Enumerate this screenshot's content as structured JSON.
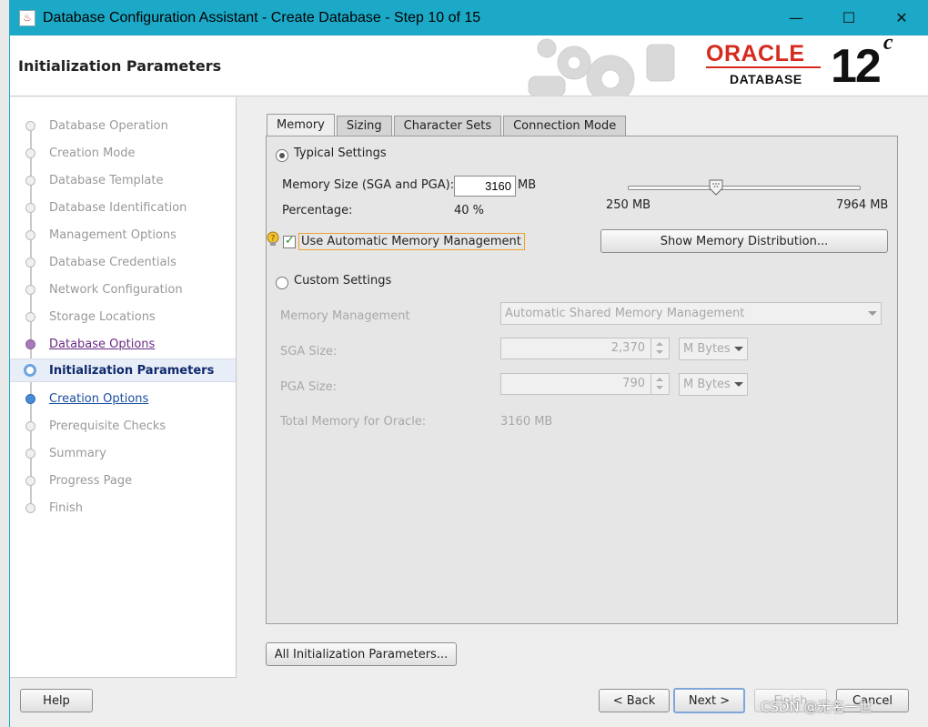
{
  "window": {
    "title": "Database Configuration Assistant - Create Database - Step 10 of 15",
    "controls": {
      "minimize": "—",
      "maximize": "☐",
      "close": "✕"
    }
  },
  "header": {
    "page_title": "Initialization Parameters",
    "brand": {
      "oracle": "ORACLE",
      "database": "DATABASE",
      "version": "12",
      "version_suffix": "c"
    }
  },
  "steps": [
    {
      "label": "Database Operation",
      "state": "done"
    },
    {
      "label": "Creation Mode",
      "state": "done"
    },
    {
      "label": "Database Template",
      "state": "done"
    },
    {
      "label": "Database Identification",
      "state": "done"
    },
    {
      "label": "Management Options",
      "state": "done"
    },
    {
      "label": "Database Credentials",
      "state": "done"
    },
    {
      "label": "Network Configuration",
      "state": "done"
    },
    {
      "label": "Storage Locations",
      "state": "done"
    },
    {
      "label": "Database Options",
      "state": "visited"
    },
    {
      "label": "Initialization Parameters",
      "state": "current"
    },
    {
      "label": "Creation Options",
      "state": "next"
    },
    {
      "label": "Prerequisite Checks",
      "state": "pending"
    },
    {
      "label": "Summary",
      "state": "pending"
    },
    {
      "label": "Progress Page",
      "state": "pending"
    },
    {
      "label": "Finish",
      "state": "pending"
    }
  ],
  "tabs": [
    "Memory",
    "Sizing",
    "Character Sets",
    "Connection Mode"
  ],
  "memory": {
    "typical_label": "Typical Settings",
    "memory_size_label": "Memory Size (SGA and PGA):",
    "memory_size_value": "3160",
    "memory_size_unit": "MB",
    "percentage_label": "Percentage:",
    "percentage_value": "40 %",
    "slider_min": "250 MB",
    "slider_max": "7964 MB",
    "slider_value_mb": 3160,
    "amm_label": "Use Automatic Memory Management",
    "amm_checked": true,
    "show_distribution_button": "Show Memory Distribution...",
    "custom_label": "Custom Settings",
    "memory_mgmt_label": "Memory Management",
    "memory_mgmt_value": "Automatic Shared Memory Management",
    "sga_label": "SGA Size:",
    "sga_value": "2,370",
    "sga_unit": "M Bytes",
    "pga_label": "PGA Size:",
    "pga_value": "790",
    "pga_unit": "M Bytes",
    "total_label": "Total Memory for Oracle:",
    "total_value": "3160 MB"
  },
  "buttons": {
    "all_params": "All Initialization Parameters...",
    "help": "Help",
    "back": "< Back",
    "next": "Next >",
    "finish": "Finish",
    "cancel": "Cancel"
  },
  "watermark": "CSDN @无名一世"
}
